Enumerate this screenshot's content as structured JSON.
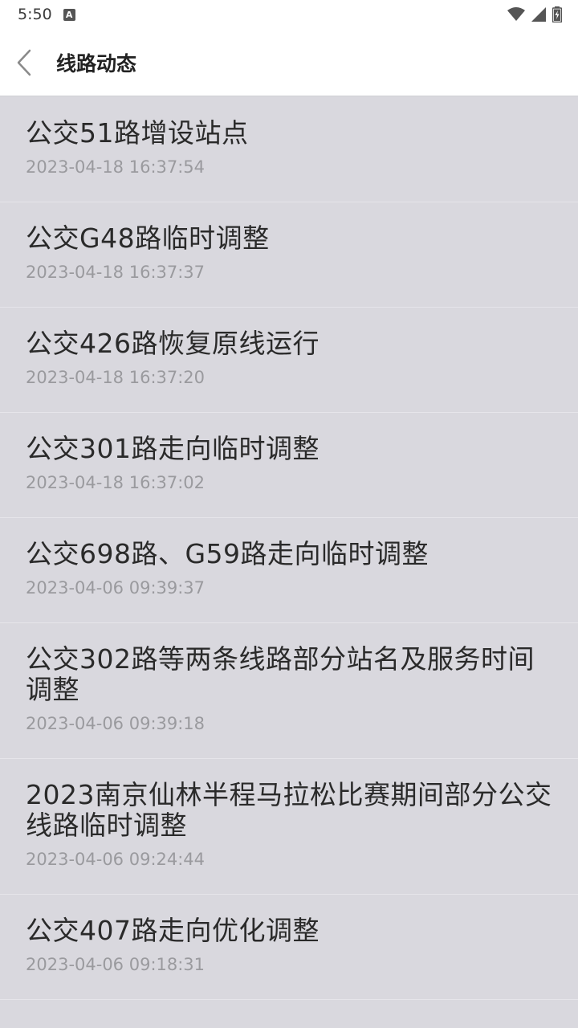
{
  "status_bar": {
    "time": "5:50",
    "notification_glyph": "A",
    "icons": [
      "wifi-icon",
      "signal-icon",
      "battery-icon"
    ]
  },
  "app_bar": {
    "back_icon": "chevron-left-icon",
    "title": "线路动态"
  },
  "news": [
    {
      "title": "公交51路增设站点",
      "time": "2023-04-18 16:37:54"
    },
    {
      "title": "公交G48路临时调整",
      "time": "2023-04-18 16:37:37"
    },
    {
      "title": "公交426路恢复原线运行",
      "time": "2023-04-18 16:37:20"
    },
    {
      "title": "公交301路走向临时调整",
      "time": "2023-04-18 16:37:02"
    },
    {
      "title": "公交698路、G59路走向临时调整",
      "time": "2023-04-06 09:39:37"
    },
    {
      "title": "公交302路等两条线路部分站名及服务时间调整",
      "time": "2023-04-06 09:39:18"
    },
    {
      "title": "2023南京仙林半程马拉松比赛期间部分公交线路临时调整",
      "time": "2023-04-06 09:24:44"
    },
    {
      "title": "公交407路走向优化调整",
      "time": "2023-04-06 09:18:31"
    }
  ],
  "colors": {
    "list_background": "#d9d8de",
    "bar_background": "#ffffff",
    "title_text": "#2a2a2a",
    "time_text": "#9a9a9e"
  }
}
